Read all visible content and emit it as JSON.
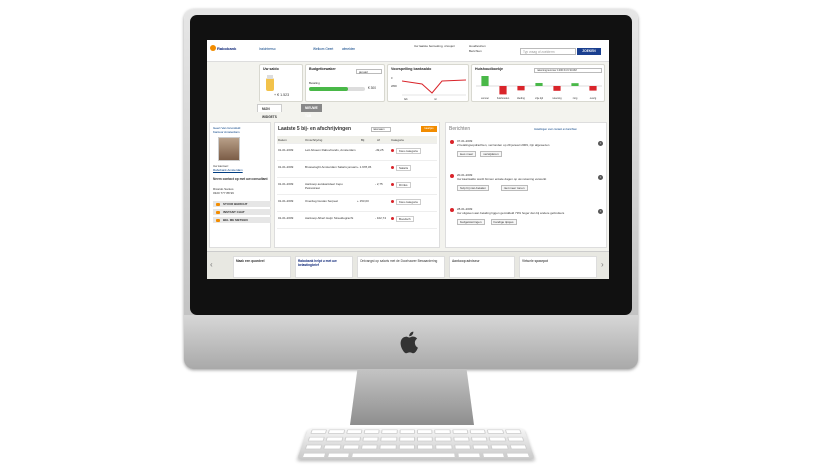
{
  "brand": {
    "logo": "Rabobank",
    "accent": "#f28c00",
    "navy": "#0c2577"
  },
  "header": {
    "nav": [
      "Inzichtrerso",
      "Welkom Geert",
      "afmelden"
    ],
    "info_lines": [
      "Uw laatste bezoeking, vrtoujeri",
      "Houdlevirien",
      "Berichten"
    ],
    "search_placeholder": "Typ vraag of zoekterm",
    "search_button": "ZOEKEN"
  },
  "widgets": {
    "saldo": {
      "title": "Uw saldo",
      "amount": "+ € 1.523"
    },
    "budget": {
      "title": "Budgetbewaker",
      "select": "januari",
      "label": "Betaling",
      "amount": "€ 300",
      "progress": 0.7
    },
    "voorspelling": {
      "title": "Voorspelling banksaldo",
      "y_labels": [
        "0",
        "2800"
      ],
      "x_labels": [
        "feb",
        "mr"
      ]
    },
    "huishoud": {
      "title": "Huishoudboekje",
      "select": "rekeningnummer 1300 64 9 SC3M",
      "categories": [
        "vervoer",
        "huishouden",
        "kleding",
        "vrije tijd",
        "rekening",
        "zorg",
        "overig"
      ],
      "values": [
        4571,
        -3840,
        -2000,
        1380,
        -2200,
        1290,
        -2100
      ]
    }
  },
  "tabs": [
    "MIJN WIDGETS",
    "NIEUWE TAB"
  ],
  "contact": {
    "adviseur": [
      "Geert Van Grunsfeld",
      "Kantoor Amsterdam"
    ],
    "kantoor_label": "Uw kantoor:",
    "kantoor": "Rabobank Amsterdam",
    "cta": "Neem contact op met uw consultant",
    "name": "Ricardo Santos",
    "phone": "0320 777 88 99",
    "buttons": [
      "STUUR BERICHT",
      "INSTANT CHAT",
      "BEL ME METEEN"
    ]
  },
  "transactions": {
    "title": "Laatste 5 bij- en afschrijvingen",
    "select": "rekenaam",
    "badge": "kaartjes",
    "headers": [
      "Datum",
      "Omschrijving",
      "Bij",
      "Af",
      "Categorie"
    ],
    "rows": [
      {
        "date": "01-01-2009",
        "desc": "Lett Abseon Rabovtrands, Amsterdam",
        "bij": "",
        "af": "-49,25",
        "cat": "Kies categorie"
      },
      {
        "date": "01-01-2009",
        "desc": "Brusseloght Amsterdam Salaris januari",
        "bij": "+ 1.978,36",
        "af": "",
        "cat": "Salaris"
      },
      {
        "date": "01-01-2009",
        "desc": "Aankoop autokantdeel Cepo Petrestraat",
        "bij": "",
        "af": "- 2,75",
        "cat": "Drinks"
      },
      {
        "date": "01-01-2009",
        "desc": "Overdag Gustav Serpeel",
        "bij": "+ 153,00",
        "af": "",
        "cat": "Kies categorie"
      },
      {
        "date": "01-01-2009",
        "desc": "Aankoop Albert Heijn Streeklegracht",
        "bij": "",
        "af": "- 102,74",
        "cat": "Boodsch"
      }
    ]
  },
  "messages": {
    "title": "Berichten",
    "settings": "Instellingen voor contact en berichten",
    "items": [
      {
        "date": "07-01-2009",
        "text": "2 betalingsopdrachten, verzonden op 29 januari 2009, zijn afgewezen",
        "actions": [
          "lees meer",
          "verwijderen"
        ]
      },
      {
        "date": "20-01-2009",
        "text": "Uw kaartsaldo wordt binnen enkele dagen op uw rekening verwerkt",
        "actions": [
          "hulp bij niet-betalen",
          "niet meer tonen"
        ]
      },
      {
        "date": "28-01-2009",
        "text": "Uw uitgaven aan betaling liggen gemiddeld 79% hoger dan bij andere gebruikers",
        "actions": [
          "budgetstoringen",
          "handige tipsjes"
        ]
      }
    ]
  },
  "footer": {
    "banners": [
      "Maak een quardeel",
      "Rabobank helpt u met uw belastingbrief",
      "Ontvangst op salaris met de Doorhaarer Bewaardering",
      "Aankoop adviseur",
      "Virtuele spaarpot"
    ]
  }
}
